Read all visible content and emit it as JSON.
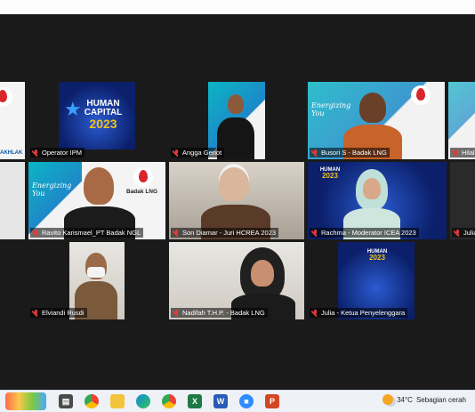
{
  "participants": [
    {
      "name": "Operator IPM"
    },
    {
      "name": "Angga Genot"
    },
    {
      "name": "Busori S - Badak LNG"
    },
    {
      "name": "Hilal"
    },
    {
      "name": "Ravito Karismael_PT Badak NGL"
    },
    {
      "name": "Son Diamar - Juri HCREA 2023"
    },
    {
      "name": "Rachma - Moderator ICEA 2023"
    },
    {
      "name": "Julia"
    },
    {
      "name": "Elviandi Rusdi"
    },
    {
      "name": "Nadifah T.H.P. - Badak LNG"
    },
    {
      "name": "Julia - Ketua Penyelenggara"
    }
  ],
  "tile_texts": {
    "akhlak": "AKHLAK",
    "human_capital": "HUMAN",
    "capital": "CAPITAL",
    "year": "2023",
    "badak_lng": "Badak LNG",
    "energizing": "Energizing You"
  },
  "active_speaker": "Rachma - Moderator ICEA 2023",
  "weather": {
    "temp": "34°C",
    "desc": "Sebagian cerah"
  },
  "taskbar_icons": [
    "widgets-icon",
    "file-manager-icon",
    "chrome-icon",
    "folder-icon",
    "edge-icon",
    "chrome-alt-icon",
    "excel-icon",
    "word-icon",
    "zoom-icon",
    "powerpoint-icon"
  ],
  "colors": {
    "active_border": "#e6e23a",
    "muted_mic": "#e23a3a",
    "meeting_bg": "#1a1a1a"
  }
}
